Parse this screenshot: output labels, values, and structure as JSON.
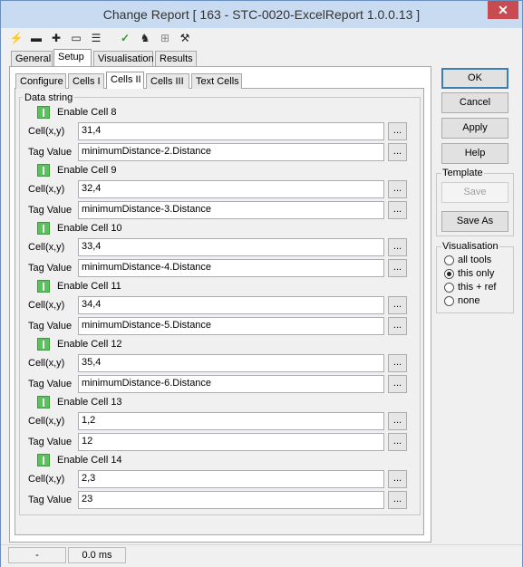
{
  "window": {
    "title": "Change Report [ 163 - STC-0020-ExcelReport 1.0.0.13 ]",
    "close_glyph": "✕"
  },
  "toolbar": {
    "icons": [
      "lightning-icon",
      "chain-link-icon",
      "puzzle-icon",
      "console-icon",
      "document-list-icon",
      "checkmark-icon",
      "run-person-icon",
      "network-icon",
      "wrench-icon"
    ]
  },
  "tabs_top": [
    "General",
    "Setup",
    "Visualisation",
    "Results"
  ],
  "tabs_inner": [
    "Configure",
    "Cells I",
    "Cells II",
    "Cells III",
    "Text Cells"
  ],
  "group_label": "Data string",
  "labels": {
    "cell": "Cell(x,y)",
    "tag": "Tag Value",
    "dots": "..."
  },
  "cells": [
    {
      "enable": "Enable Cell 8",
      "cell": "31,4",
      "tag": "minimumDistance-2.Distance"
    },
    {
      "enable": "Enable Cell 9",
      "cell": "32,4",
      "tag": "minimumDistance-3.Distance"
    },
    {
      "enable": "Enable Cell 10",
      "cell": "33,4",
      "tag": "minimumDistance-4.Distance"
    },
    {
      "enable": "Enable Cell 11",
      "cell": "34,4",
      "tag": "minimumDistance-5.Distance"
    },
    {
      "enable": "Enable Cell 12",
      "cell": "35,4",
      "tag": "minimumDistance-6.Distance"
    },
    {
      "enable": "Enable Cell 13",
      "cell": "1,2",
      "tag": "12"
    },
    {
      "enable": "Enable Cell 14",
      "cell": "2,3",
      "tag": "23"
    }
  ],
  "buttons": {
    "ok": "OK",
    "cancel": "Cancel",
    "apply": "Apply",
    "help": "Help",
    "save": "Save",
    "save_as": "Save As"
  },
  "template_label": "Template",
  "visualisation": {
    "label": "Visualisation",
    "options": [
      "all tools",
      "this only",
      "this + ref",
      "none"
    ],
    "selected": "this only"
  },
  "status": {
    "left": "-",
    "time": "0.0 ms"
  }
}
